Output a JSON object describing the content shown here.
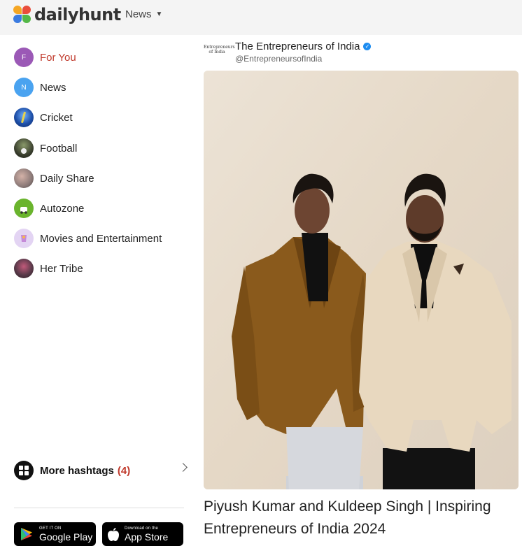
{
  "header": {
    "brand": "dailyhunt",
    "nav_label": "News"
  },
  "sidebar": {
    "items": [
      {
        "label": "For You",
        "initial": "F",
        "color": "#9b59b6",
        "active": true
      },
      {
        "label": "News",
        "initial": "N",
        "color": "#4aa3f0",
        "active": false
      },
      {
        "label": "Cricket",
        "initial": "",
        "color": "#2e5fb0",
        "active": false
      },
      {
        "label": "Football",
        "initial": "",
        "color": "#3a3f2e",
        "active": false
      },
      {
        "label": "Daily Share",
        "initial": "",
        "color": "#8c7a78",
        "active": false
      },
      {
        "label": "Autozone",
        "initial": "",
        "color": "#6ab42d",
        "active": false
      },
      {
        "label": "Movies and Entertainment",
        "initial": "",
        "color": "#d8c7ef",
        "active": false
      },
      {
        "label": "Her Tribe",
        "initial": "",
        "color": "#5a3a4a",
        "active": false
      }
    ],
    "more": {
      "label": "More hashtags",
      "count": "(4)"
    },
    "stores": {
      "google_small": "GET IT ON",
      "google_big": "Google Play",
      "apple_small": "Download on the",
      "apple_big": "App Store"
    }
  },
  "article": {
    "source_logo_text": "Entrepreneurs of India",
    "source_name": "The Entrepreneurs of India",
    "source_handle": "@EntrepreneursofIndia",
    "headline": "Piyush Kumar and Kuldeep Singh | Inspiring Entrepreneurs of India 2024"
  }
}
